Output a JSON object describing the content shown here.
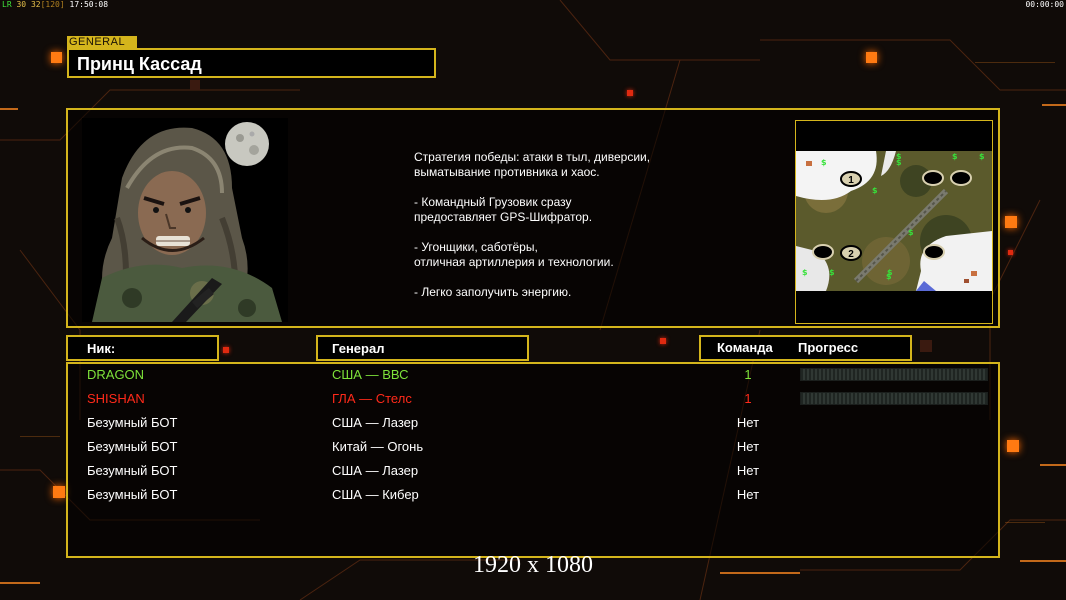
{
  "hud": {
    "left_tag": "LR",
    "fps": "30",
    "fps2": "32",
    "fps_max": "[120]",
    "clock": "17:50:08",
    "timer": "00:00:00"
  },
  "general": {
    "tag": "GENERAL",
    "name": "Принц Кассад"
  },
  "strategy_text": "Стратегия победы: атаки в тыл, диверсии,\n выматывание противника и хаос.\n\n- Командный Грузовик сразу\nпредоставляет GPS-Шифратор.\n\n- Угонщики, саботёры,\nотличная артиллерия и технологии.\n\n- Легко заполучить энергию.",
  "minimap": {
    "start_1": "1",
    "start_2": "2",
    "resource_icon": "dollar-sign"
  },
  "columns": {
    "nick": "Ник:",
    "general": "Генерал",
    "team": "Команда",
    "progress": "Прогресс"
  },
  "players": [
    {
      "name": "DRAGON",
      "general": "США — ВВС",
      "team": "1",
      "color": "#7ee23a",
      "progress": 0
    },
    {
      "name": "SHISHAN",
      "general": "ГЛА — Стелс",
      "team": "1",
      "color": "#ff2a1a",
      "progress": 0
    },
    {
      "name": "Безумный БОТ",
      "general": "США — Лазер",
      "team": "Нет",
      "color": "#ffffff"
    },
    {
      "name": "Безумный БОТ",
      "general": "Китай — Огонь",
      "team": "Нет",
      "color": "#ffffff"
    },
    {
      "name": "Безумный БОТ",
      "general": "США — Лазер",
      "team": "Нет",
      "color": "#ffffff"
    },
    {
      "name": "Безумный БОТ",
      "general": "США — Кибер",
      "team": "Нет",
      "color": "#ffffff"
    }
  ],
  "resolution": "1920 x 1080",
  "colors": {
    "frame": "#d4b51c",
    "accent": "#ff7a12"
  }
}
